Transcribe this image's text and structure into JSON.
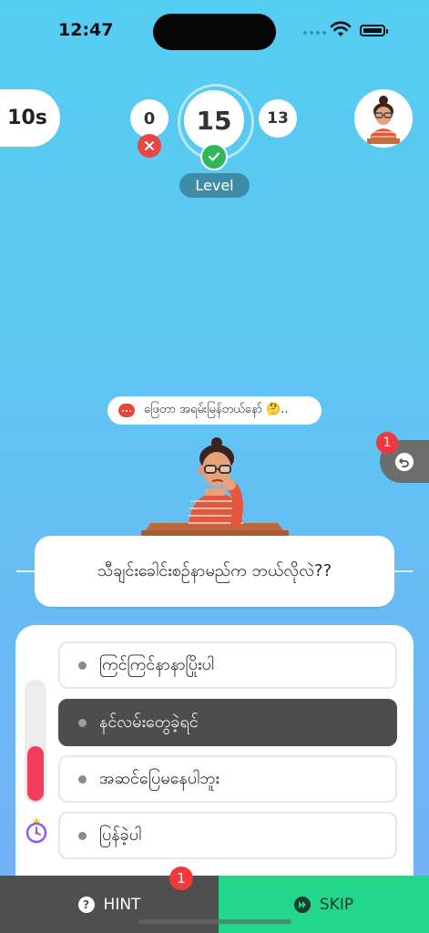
{
  "status_bar": {
    "time": "12:47"
  },
  "hud": {
    "timer": "10s",
    "wrong_count": "0",
    "level_number": "15",
    "right_count": "13",
    "level_label": "Level"
  },
  "speech_bubble": {
    "text": "ဖြေတာ အရမ်းမြန်တယ်နော် 🤔.."
  },
  "undo": {
    "badge": "1"
  },
  "question": {
    "text": "သီချင်းခေါင်းစဉ်နာမည်က ဘယ်လိုလဲ??"
  },
  "timer_progress": {
    "remaining_fraction": 0.46
  },
  "answers": [
    {
      "label": "ကြင်ကြင်နာနာပြိုးပါ",
      "selected": false
    },
    {
      "label": "နင်လမ်းတွေခဲ့ရင်",
      "selected": true
    },
    {
      "label": "အဆင်ပြေမနေပါဘူး",
      "selected": false
    },
    {
      "label": "ပြန်ခဲ့ပါ",
      "selected": false
    }
  ],
  "bottom_bar": {
    "hint_label": "HINT",
    "hint_badge": "1",
    "skip_label": "SKIP"
  },
  "colors": {
    "background_top": "#55cdf2",
    "background_bottom": "#74b1f6",
    "hint_bar": "#4f4f4f",
    "skip_bar": "#22d68a",
    "selected_answer": "#4d4d4d",
    "timer_fill": "#f23d5c",
    "badge_red": "#f03a3a",
    "level_badge": "#3d8da8"
  }
}
